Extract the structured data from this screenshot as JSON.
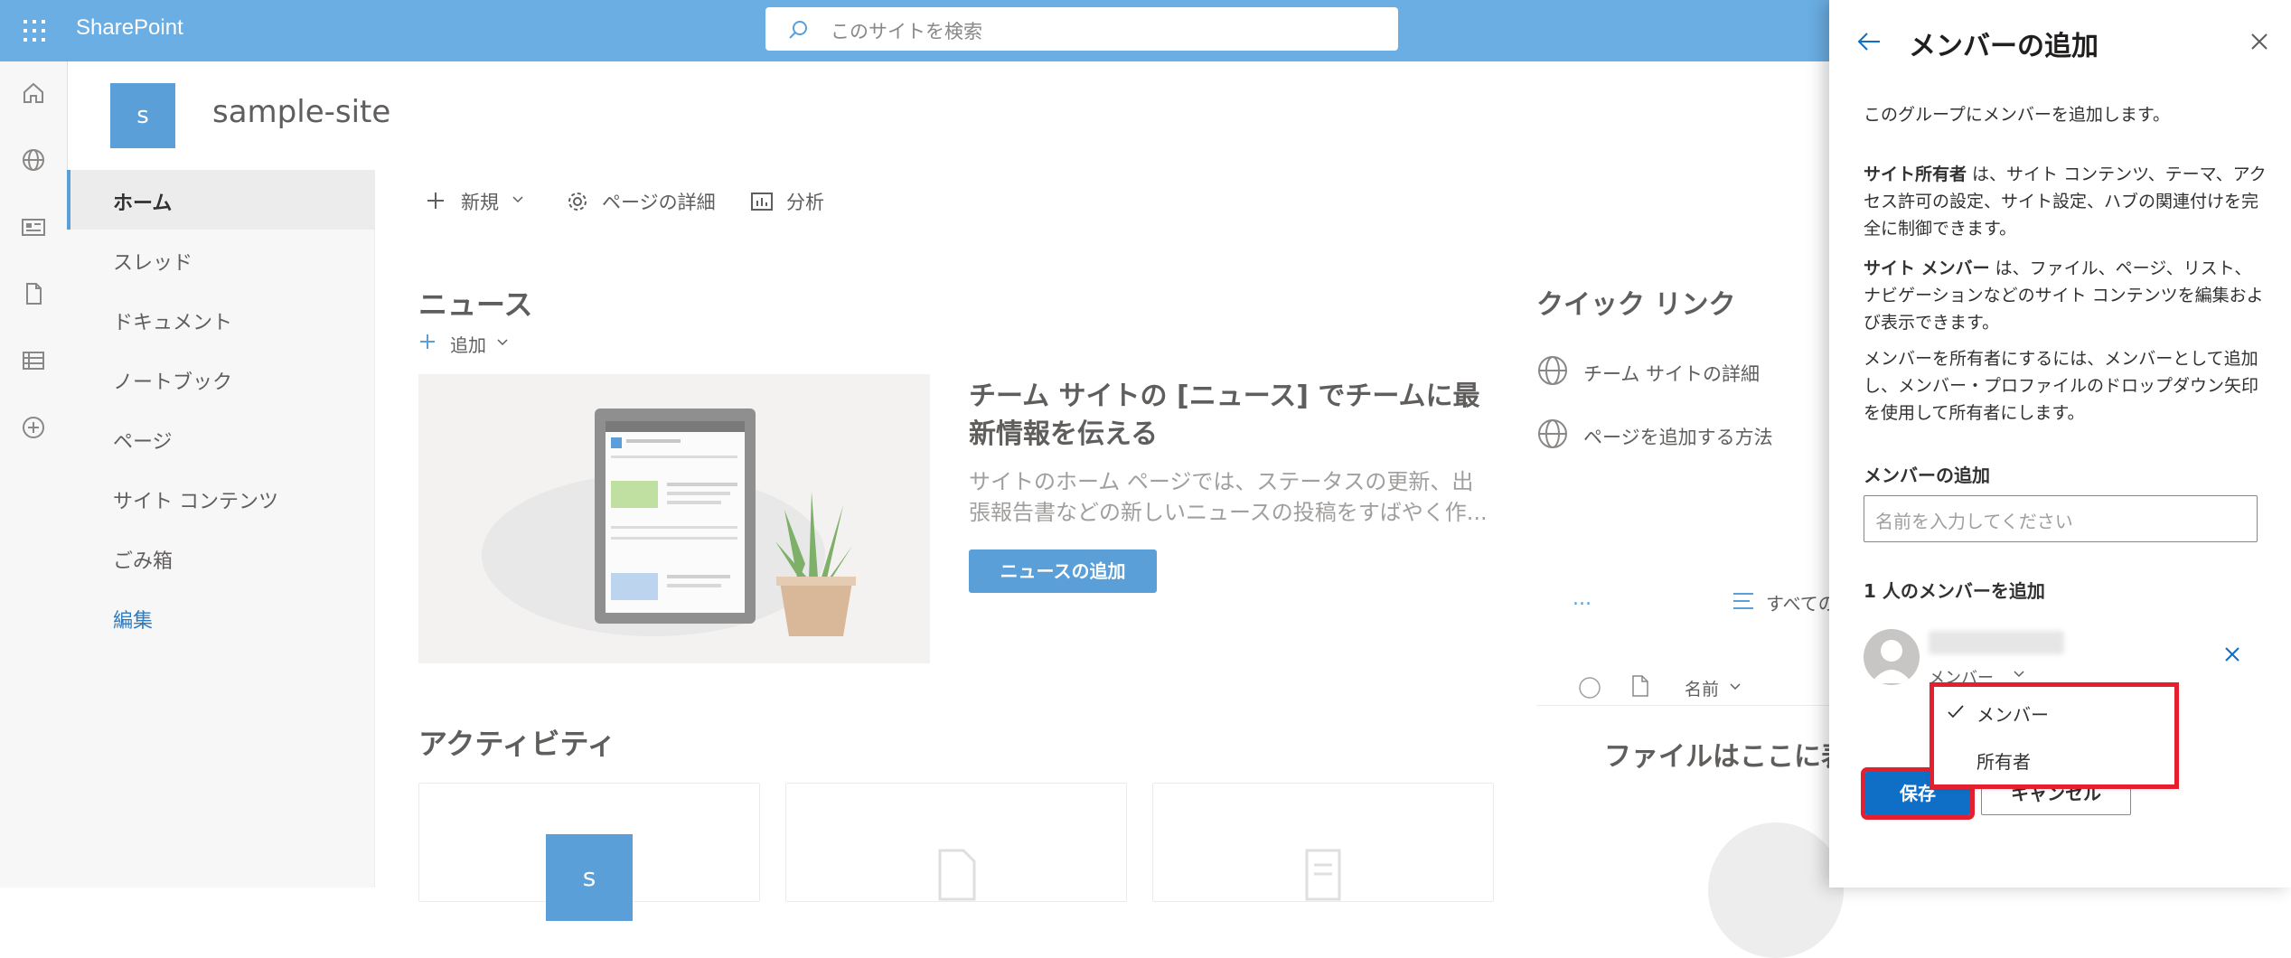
{
  "app": {
    "name": "SharePoint"
  },
  "search": {
    "placeholder": "このサイトを検索"
  },
  "rail": {
    "icons": [
      "home-icon",
      "globe-icon",
      "news-icon",
      "document-icon",
      "list-icon",
      "add-circle-icon"
    ]
  },
  "site": {
    "logo_letter": "s",
    "name": "sample-site"
  },
  "nav": {
    "items": [
      {
        "label": "ホーム",
        "active": true
      },
      {
        "label": "スレッド"
      },
      {
        "label": "ドキュメント"
      },
      {
        "label": "ノートブック"
      },
      {
        "label": "ページ"
      },
      {
        "label": "サイト コンテンツ"
      },
      {
        "label": "ごみ箱"
      },
      {
        "label": "編集",
        "link": true
      }
    ]
  },
  "commandbar": {
    "new": "新規",
    "page_details": "ページの詳細",
    "analytics": "分析"
  },
  "news": {
    "title": "ニュース",
    "add": "追加",
    "headline": "チーム サイトの [ニュース] でチームに最新情報を伝える",
    "description": "サイトのホーム ページでは、ステータスの更新、出張報告書などの新しいニュースの投稿をすばやく作...",
    "button": "ニュースの追加"
  },
  "quick_links": {
    "title": "クイック リンク",
    "items": [
      "チーム サイトの詳細",
      "ページを追加する方法"
    ]
  },
  "documents": {
    "ellipsis": "...",
    "all_label": "すべての",
    "name_column": "名前",
    "empty_text": "ファイルはここに表"
  },
  "activity": {
    "title": "アクティビティ",
    "card_letter": "s"
  },
  "panel": {
    "title": "メンバーの追加",
    "intro": "このグループにメンバーを追加します。",
    "owner_bold": "サイト所有者",
    "owner_text": " は、サイト コンテンツ、テーマ、アクセス許可の設定、サイト設定、ハブの関連付けを完全に制御できます。",
    "member_bold": "サイト メンバー",
    "member_text": " は、ファイル、ページ、リスト、ナビゲーションなどのサイト コンテンツを編集および表示できます。",
    "owner_howto": "メンバーを所有者にするには、メンバーとして追加し、メンバー・プロファイルのドロップダウン矢印を使用して所有者にします。",
    "add_label": "メンバーの追加",
    "input_placeholder": "名前を入力してください",
    "count_label": "1 人のメンバーを追加",
    "member_role": "メンバー",
    "role_options": [
      {
        "label": "メンバー",
        "selected": true
      },
      {
        "label": "所有者"
      }
    ],
    "save": "保存",
    "cancel": "キャンセル"
  },
  "colors": {
    "suite_bar": "#6aaee3",
    "accent": "#5a9fd8",
    "primary_button": "#0f6fc6",
    "highlight": "#e5202e"
  }
}
